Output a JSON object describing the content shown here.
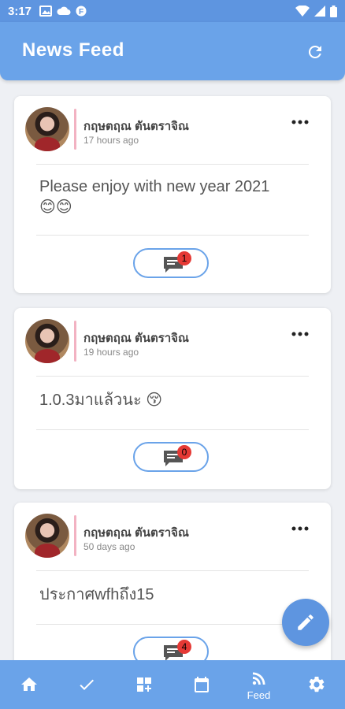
{
  "status_bar": {
    "time": "3:17"
  },
  "app_bar": {
    "title": "News Feed",
    "refresh_icon": "refresh-icon"
  },
  "posts": [
    {
      "author": "กฤษตฤณ ตันตราจิณ",
      "time_ago": "17 hours ago",
      "content_line1": "Please enjoy with new year 2021",
      "content_line2": "😊😊",
      "comment_count": "1"
    },
    {
      "author": "กฤษตฤณ ตันตราจิณ",
      "time_ago": "19 hours ago",
      "content_line1": "1.0.3มาแล้วนะ 😚",
      "content_line2": "",
      "comment_count": "0"
    },
    {
      "author": "กฤษตฤณ ตันตราจิณ",
      "time_ago": "50 days ago",
      "content_line1": "ประกาศwfhถึง15",
      "content_line2": "",
      "comment_count": "4"
    }
  ],
  "bottom_nav": {
    "items": [
      {
        "icon": "home-icon",
        "label": ""
      },
      {
        "icon": "check-icon",
        "label": ""
      },
      {
        "icon": "dashboard-add-icon",
        "label": ""
      },
      {
        "icon": "calendar-icon",
        "label": ""
      },
      {
        "icon": "rss-feed-icon",
        "label": "Feed"
      },
      {
        "icon": "settings-icon",
        "label": ""
      }
    ]
  },
  "colors": {
    "primary": "#6aa3e9",
    "badge": "#e53935",
    "accent_bar": "#f2b2c2"
  }
}
